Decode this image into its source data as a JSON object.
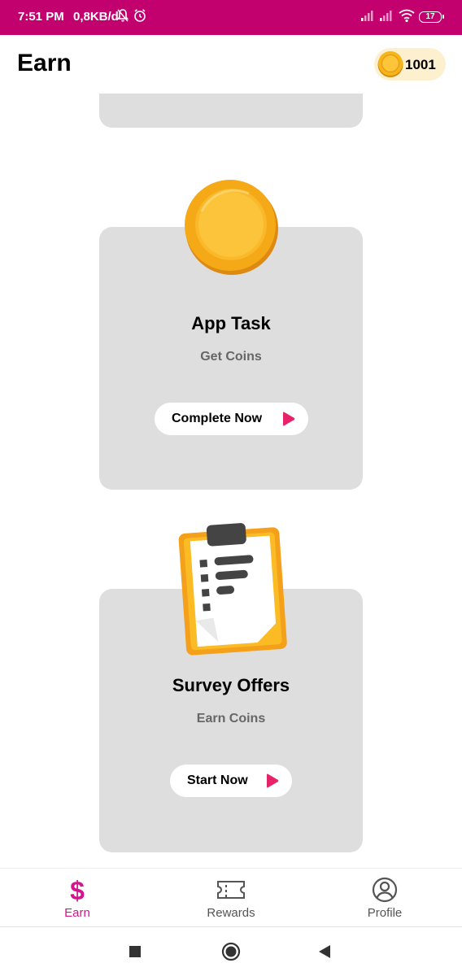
{
  "status_bar": {
    "time": "7:51 PM",
    "net_speed": "0,8KB/d",
    "battery": "17",
    "background_color": "#c2006e",
    "icons": [
      "mute-bell-icon",
      "alarm-icon",
      "signal-icon",
      "signal-icon",
      "wifi-icon",
      "battery-icon"
    ]
  },
  "header": {
    "title": "Earn",
    "coin_balance": "1001",
    "coin_icon": "coin-icon"
  },
  "cards": [
    {
      "title": "App Task",
      "subtitle": "Get Coins",
      "button_label": "Complete Now",
      "image": "coin-icon",
      "button_icon": "play-icon"
    },
    {
      "title": "Survey Offers",
      "subtitle": "Earn Coins",
      "button_label": "Start Now",
      "image": "clipboard-icon",
      "button_icon": "play-icon"
    }
  ],
  "bottom_nav": {
    "items": [
      {
        "label": "Earn",
        "icon": "dollar-icon",
        "active": true
      },
      {
        "label": "Rewards",
        "icon": "ticket-icon",
        "active": false
      },
      {
        "label": "Profile",
        "icon": "profile-icon",
        "active": false
      }
    ],
    "active_color": "#d4148a",
    "inactive_color": "#555555"
  },
  "system_nav": {
    "icons": [
      "recents-square-icon",
      "home-circle-icon",
      "back-triangle-icon"
    ]
  },
  "colors": {
    "brand": "#c2006e",
    "card_bg": "#dedede",
    "coin_gold": "#f7b51c",
    "coin_pill_bg": "#fdf0cf"
  }
}
